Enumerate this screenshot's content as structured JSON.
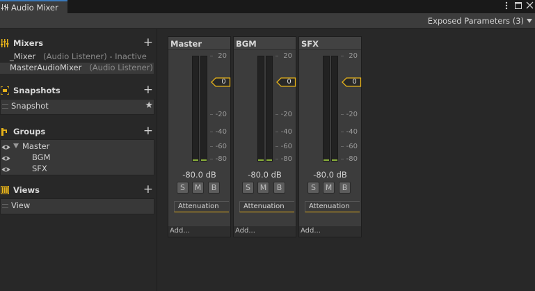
{
  "window": {
    "tab_title": "Audio Mixer",
    "menu_icon": "kebab-menu-icon",
    "maximize_icon": "maximize-icon"
  },
  "toolbar": {
    "exposed_parameters": "Exposed Parameters (3)"
  },
  "sidebar": {
    "mixers": {
      "title": "Mixers",
      "add": "+",
      "items": [
        {
          "name": "_Mixer",
          "meta": "(Audio Listener) - Inactive"
        },
        {
          "name": "MasterAudioMixer",
          "meta": "(Audio Listener) -"
        }
      ]
    },
    "snapshots": {
      "title": "Snapshots",
      "add": "+",
      "items": [
        {
          "name": "Snapshot",
          "starred": true
        }
      ],
      "star": "★"
    },
    "groups": {
      "title": "Groups",
      "add": "+",
      "items": [
        {
          "name": "Master",
          "expanded": true
        },
        {
          "name": "BGM"
        },
        {
          "name": "SFX"
        }
      ]
    },
    "views": {
      "title": "Views",
      "add": "+",
      "items": [
        {
          "name": "View"
        }
      ]
    }
  },
  "strips": [
    {
      "name": "Master",
      "db": "-80.0 dB",
      "s": "S",
      "m": "M",
      "b": "B",
      "effect": "Attenuation",
      "add": "Add...",
      "fader": "0"
    },
    {
      "name": "BGM",
      "db": "-80.0 dB",
      "s": "S",
      "m": "M",
      "b": "B",
      "effect": "Attenuation",
      "add": "Add...",
      "fader": "0"
    },
    {
      "name": "SFX",
      "db": "-80.0 dB",
      "s": "S",
      "m": "M",
      "b": "B",
      "effect": "Attenuation",
      "add": "Add...",
      "fader": "0"
    }
  ],
  "scale": [
    "20",
    "0",
    "-20",
    "-40",
    "-60",
    "-80"
  ],
  "colors": {
    "accent": "#e6b21a",
    "meter_level": "#8ab03a",
    "tab_highlight": "#3a79bb"
  }
}
